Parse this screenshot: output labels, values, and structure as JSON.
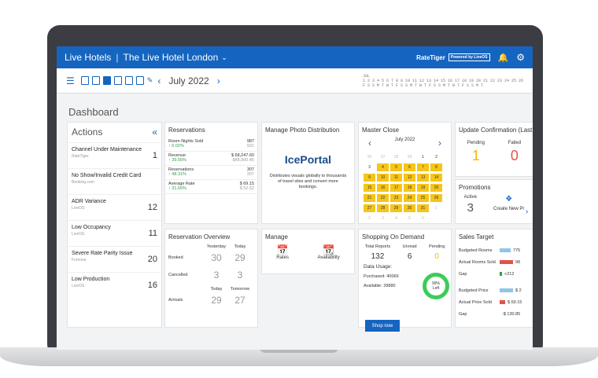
{
  "header": {
    "org": "Live Hotels",
    "hotel": "The Live Hotel London",
    "brand": "RateTiger",
    "powered": "Powered by LiveOS"
  },
  "toolbar": {
    "month": "July 2022",
    "strip_label": "JUL"
  },
  "page_title": "Dashboard",
  "actions": {
    "title": "Actions",
    "items": [
      {
        "name": "Channel Under Maintenance",
        "source": "RateTiger",
        "count": "1"
      },
      {
        "name": "No Show/Invalid Credit Card",
        "source": "Booking.com",
        "count": ""
      },
      {
        "name": "ADR Variance",
        "source": "LiveOS",
        "count": "12"
      },
      {
        "name": "Low Occupancy",
        "source": "LiveOS",
        "count": "11"
      },
      {
        "name": "Severe Rate Parity Issue",
        "source": "Fornova",
        "count": "20"
      },
      {
        "name": "Low Production",
        "source": "LiveOS",
        "count": "16"
      }
    ]
  },
  "reservations": {
    "title": "Reservations",
    "rows": [
      {
        "label": "Room Nights Sold",
        "value": "987",
        "change": "6.02%",
        "prev": "931"
      },
      {
        "label": "Revenue",
        "value": "$ 68,247.60",
        "change": "39.56%",
        "prev": "$48,900.45"
      },
      {
        "label": "Reservations",
        "value": "307",
        "change": "48.31%",
        "prev": "207"
      },
      {
        "label": "Average Rate",
        "value": "$ 69.15",
        "change": "31.65%",
        "prev": "$ 52.52"
      }
    ]
  },
  "photo": {
    "title": "Manage Photo Distribution",
    "logo": "IcePortal",
    "desc": "Distributes visuals globally to thousands of travel sites and convert more bookings."
  },
  "master_close": {
    "title": "Master Close",
    "month": "July 2022",
    "days": [
      "26",
      "27",
      "28",
      "29",
      "1",
      "2",
      "3",
      "4",
      "5",
      "6",
      "7",
      "8",
      "9",
      "10",
      "11",
      "12",
      "13",
      "14",
      "15",
      "16",
      "17",
      "18",
      "19",
      "20",
      "21",
      "22",
      "23",
      "24",
      "25",
      "26",
      "27",
      "28",
      "29",
      "30",
      "31",
      "1",
      "2",
      "3",
      "4",
      "5",
      "6"
    ]
  },
  "update_conf": {
    "title": "Update Confirmation (Last 7 D",
    "pending_label": "Pending",
    "pending": "1",
    "failed_label": "Failed",
    "failed": "0"
  },
  "overview": {
    "title": "Reservation Overview",
    "yesterday": "Yesterday",
    "today": "Today",
    "tomorrow": "Tomorrow",
    "booked_label": "Booked",
    "booked_y": "30",
    "booked_t": "29",
    "cancelled_label": "Cancelled",
    "cancelled_y": "3",
    "cancelled_t": "3",
    "arrivals_label": "Arrivals",
    "arrivals_t": "29",
    "arrivals_tm": "27"
  },
  "manage": {
    "title": "Manage",
    "rates": "Rates",
    "availability": "Availability"
  },
  "shopping": {
    "title": "Shopping On Demand",
    "total_label": "Total Reports",
    "total": "132",
    "unread_label": "Unread",
    "unread": "6",
    "pending_label": "Pending",
    "pending": "0",
    "usage": "Data Usage:",
    "purchased": "Purchased: 40066",
    "available": "Available: 39880",
    "pct": "99%",
    "left": "Left",
    "shop_btn": "Shop now"
  },
  "promotions": {
    "title": "Promotions",
    "active_label": "Active",
    "active": "3",
    "create": "Create New Pr"
  },
  "sales_target": {
    "title": "Sales Target",
    "rows": [
      {
        "label": "Budgeted Rooms",
        "value": "775",
        "color": "#8ec5ea",
        "fill": 0.8
      },
      {
        "label": "Actual Rooms Sold",
        "value": "98",
        "color": "#e0534b",
        "fill": 0.95
      },
      {
        "label": "Gap",
        "value": "+212",
        "color": "#2e9d44",
        "fill": 0.15
      },
      {
        "label": "Budgeted Price",
        "value": "$ 2",
        "color": "#8ec5ea",
        "fill": 0.95
      },
      {
        "label": "Actual Price Sold",
        "value": "$ 69.15",
        "color": "#e0534b",
        "fill": 0.4
      },
      {
        "label": "Gap",
        "value": "-$ 130.85",
        "color": "#e0534b",
        "fill": 0
      }
    ]
  }
}
